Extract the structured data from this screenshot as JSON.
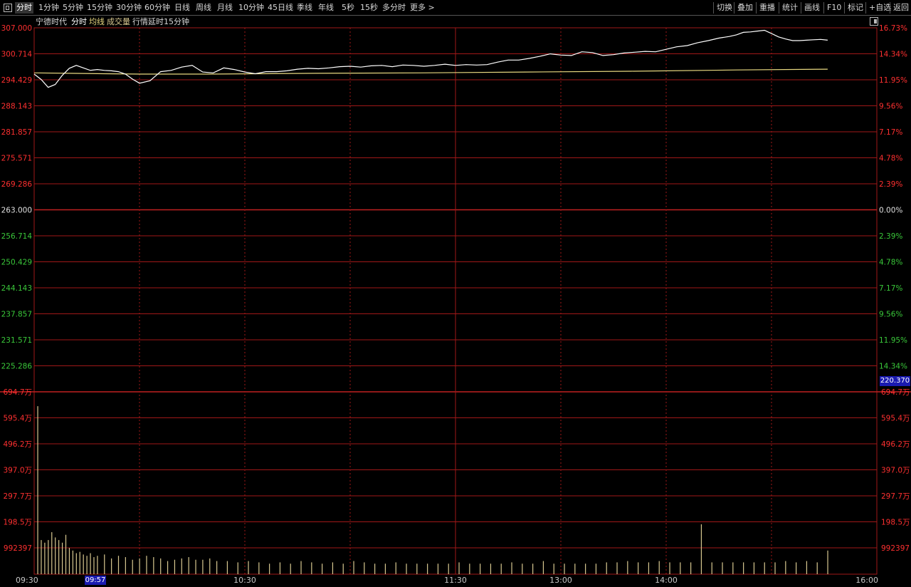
{
  "toolbar": {
    "left_icon": "menu-square-icon",
    "period_tabs": [
      "分时",
      "1分钟",
      "5分钟",
      "15分钟",
      "30分钟",
      "60分钟",
      "日线",
      "周线",
      "月线",
      "10分钟",
      "45日线",
      "季线",
      "年线",
      "5秒",
      "15秒",
      "多分时",
      "更多 >"
    ],
    "active_tab": "分时",
    "right_buttons": [
      "切换",
      "叠加",
      "重播",
      "统计",
      "画线",
      "F10",
      "标记",
      "+自选",
      "返回"
    ]
  },
  "info": {
    "stock_name": "宁德时代",
    "mode": "分时",
    "avg_label": "均线",
    "volume_label": "成交量",
    "delay_note": "行情延时15分钟",
    "collapse_icon": "panel-toggle-icon"
  },
  "colors": {
    "grid": "#a01818",
    "up": "#ff3030",
    "down": "#3ac83a",
    "flat": "#e0e0e0",
    "price_line": "#ffffff",
    "avg_line": "#e8d880",
    "volume_bar": "#d8c890",
    "badge": "#1a1ab0"
  },
  "cursor": {
    "price": "220.370",
    "time": "09:57"
  },
  "chart_data": [
    {
      "type": "line",
      "title": "",
      "prev_close": 263.0,
      "ylim": [
        219.0,
        307.0
      ],
      "y_ticks_left": [
        "307.000",
        "300.714",
        "294.429",
        "288.143",
        "281.857",
        "275.571",
        "269.286",
        "263.000",
        "256.714",
        "250.429",
        "244.143",
        "237.857",
        "231.571",
        "225.286"
      ],
      "y_ticks_right": [
        "16.73%",
        "14.34%",
        "11.95%",
        "9.56%",
        "7.17%",
        "4.78%",
        "2.39%",
        "0.00%",
        "2.39%",
        "4.78%",
        "7.17%",
        "9.56%",
        "11.95%",
        "14.34%"
      ],
      "x_ticks": [
        "09:30",
        "10:30",
        "11:30",
        "13:00",
        "14:00",
        "16:00"
      ],
      "x_units": "trading minutes from 09:30 (0–240)",
      "series": [
        {
          "key": "price",
          "x": [
            0,
            2,
            4,
            6,
            8,
            10,
            12,
            14,
            16,
            18,
            20,
            22,
            24,
            26,
            28,
            30,
            33,
            36,
            39,
            42,
            45,
            48,
            51,
            54,
            57,
            60,
            63,
            66,
            69,
            72,
            75,
            78,
            81,
            84,
            87,
            90,
            93,
            96,
            99,
            102,
            105,
            108,
            111,
            114,
            117,
            120,
            123,
            126,
            129,
            132,
            135,
            138,
            141,
            144,
            147,
            150,
            153,
            156,
            159,
            162,
            165,
            168,
            171,
            174,
            177,
            180,
            183,
            186,
            189,
            192,
            195,
            198,
            200,
            202,
            204,
            206,
            208,
            210,
            212,
            214,
            216,
            218,
            220,
            222,
            224,
            226
          ],
          "values": [
            295.8,
            294.5,
            292.6,
            293.3,
            295.5,
            297.2,
            297.9,
            297.3,
            296.7,
            296.9,
            296.7,
            296.6,
            296.4,
            295.8,
            294.6,
            293.6,
            294.2,
            296.4,
            296.7,
            297.5,
            297.9,
            296.3,
            296.1,
            297.3,
            296.9,
            296.3,
            295.9,
            296.4,
            296.4,
            296.6,
            297.0,
            297.2,
            297.1,
            297.3,
            297.6,
            297.7,
            297.5,
            297.8,
            297.9,
            297.6,
            298.0,
            297.9,
            297.7,
            297.9,
            298.2,
            297.9,
            298.1,
            298.0,
            298.1,
            298.7,
            299.2,
            299.2,
            299.6,
            300.1,
            300.7,
            300.4,
            300.3,
            301.2,
            301.0,
            300.3,
            300.5,
            300.9,
            301.1,
            301.3,
            301.2,
            301.8,
            302.4,
            302.7,
            303.4,
            303.9,
            304.5,
            304.9,
            305.3,
            305.9,
            306.0,
            306.2,
            306.4,
            305.6,
            304.8,
            304.3,
            303.9,
            303.9,
            304.0,
            304.1,
            304.2,
            304.0
          ]
        },
        {
          "key": "avg",
          "x": [
            0,
            10,
            20,
            30,
            50,
            80,
            110,
            140,
            170,
            200,
            226
          ],
          "values": [
            296.1,
            296.0,
            295.9,
            295.8,
            295.8,
            296.0,
            296.1,
            296.3,
            296.5,
            296.8,
            297.0
          ]
        }
      ]
    },
    {
      "type": "bar",
      "title": "",
      "ylim": [
        0,
        6947000
      ],
      "y_ticks": [
        "694.7万",
        "595.4万",
        "496.2万",
        "397.0万",
        "297.7万",
        "198.5万",
        "992397"
      ],
      "x_units": "trading minutes from 09:30 (0–240)",
      "x": [
        1,
        2,
        3,
        4,
        5,
        6,
        7,
        8,
        9,
        10,
        11,
        12,
        13,
        14,
        15,
        16,
        17,
        18,
        20,
        22,
        24,
        26,
        28,
        30,
        32,
        34,
        36,
        38,
        40,
        42,
        44,
        46,
        48,
        50,
        52,
        55,
        58,
        61,
        64,
        67,
        70,
        73,
        76,
        79,
        82,
        85,
        88,
        91,
        94,
        97,
        100,
        103,
        106,
        109,
        112,
        115,
        118,
        121,
        124,
        127,
        130,
        133,
        136,
        139,
        142,
        145,
        148,
        151,
        154,
        157,
        160,
        163,
        166,
        169,
        172,
        175,
        178,
        181,
        184,
        187,
        190,
        193,
        196,
        199,
        202,
        205,
        208,
        211,
        214,
        217,
        220,
        223,
        226
      ],
      "values": [
        6400000,
        1300000,
        1200000,
        1300000,
        1600000,
        1400000,
        1300000,
        1200000,
        1500000,
        1000000,
        900000,
        800000,
        850000,
        750000,
        700000,
        800000,
        650000,
        700000,
        750000,
        600000,
        700000,
        650000,
        550000,
        600000,
        700000,
        650000,
        600000,
        500000,
        550000,
        600000,
        650000,
        550000,
        550000,
        600000,
        500000,
        500000,
        450000,
        500000,
        450000,
        400000,
        450000,
        400000,
        500000,
        450000,
        400000,
        450000,
        400000,
        500000,
        450000,
        400000,
        400000,
        450000,
        400000,
        400000,
        400000,
        400000,
        400000,
        450000,
        400000,
        400000,
        400000,
        400000,
        450000,
        400000,
        400000,
        500000,
        400000,
        400000,
        400000,
        400000,
        400000,
        450000,
        450000,
        500000,
        450000,
        450000,
        500000,
        450000,
        450000,
        450000,
        1900000,
        450000,
        450000,
        450000,
        450000,
        450000,
        450000,
        450000,
        500000,
        450000,
        500000,
        450000,
        900000,
        500000,
        900000
      ]
    }
  ]
}
